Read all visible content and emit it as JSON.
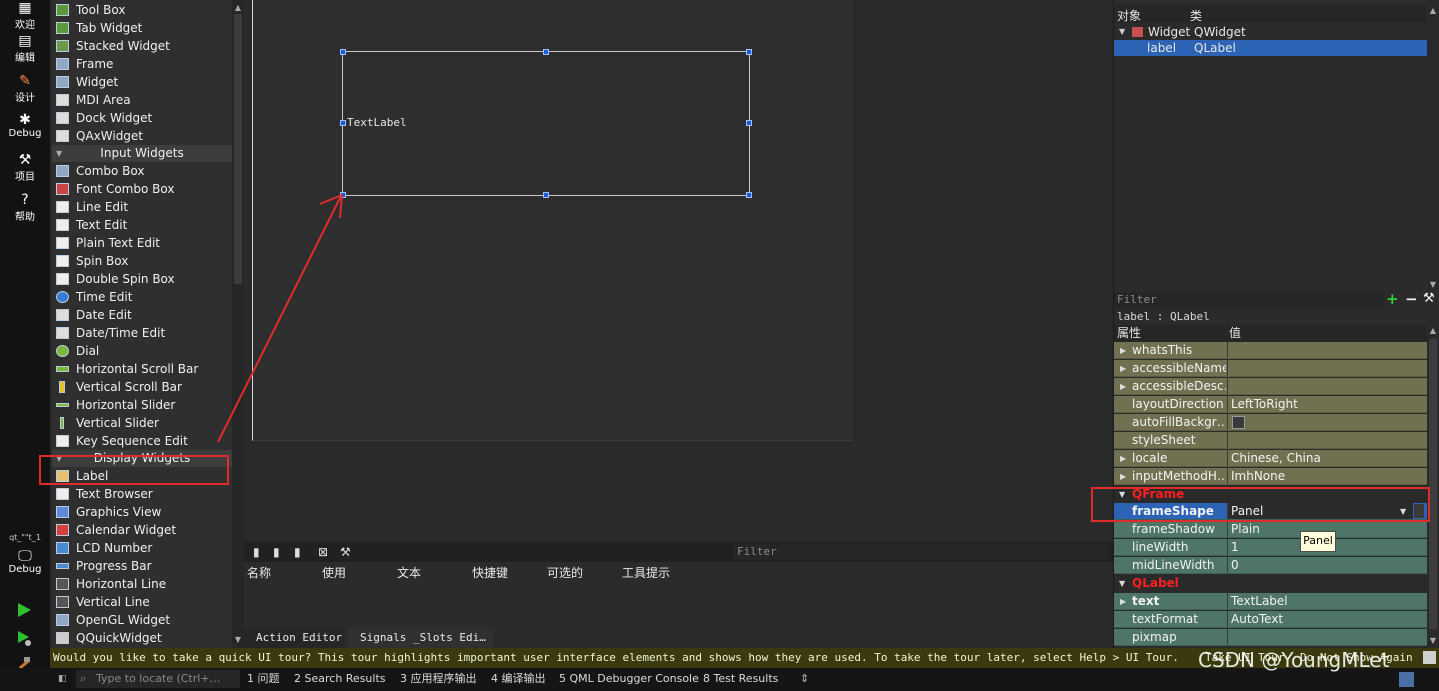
{
  "mode_bar": {
    "items": [
      {
        "label": "欢迎",
        "icon": "grid-icon"
      },
      {
        "label": "编辑",
        "icon": "document-icon"
      },
      {
        "label": "设计",
        "icon": "pencil-icon"
      },
      {
        "label": "Debug",
        "icon": "bug-icon"
      },
      {
        "label": "项目",
        "icon": "wrench-icon"
      },
      {
        "label": "帮助",
        "icon": "help-icon"
      }
    ],
    "project_label": "qt_\"\"t_1",
    "debug_label": "Debug",
    "accent_color": "#2fbf2f"
  },
  "widget_box": {
    "items_top": [
      "Tool Box",
      "Tab Widget",
      "Stacked Widget",
      "Frame",
      "Widget",
      "MDI Area",
      "Dock Widget",
      "QAxWidget"
    ],
    "category_input": "Input Widgets",
    "items_input": [
      "Combo Box",
      "Font Combo Box",
      "Line Edit",
      "Text Edit",
      "Plain Text Edit",
      "Spin Box",
      "Double Spin Box",
      "Time Edit",
      "Date Edit",
      "Date/Time Edit",
      "Dial",
      "Horizontal Scroll Bar",
      "Vertical Scroll Bar",
      "Horizontal Slider",
      "Vertical Slider",
      "Key Sequence Edit"
    ],
    "category_display": "Display Widgets",
    "items_display": [
      "Label",
      "Text Browser",
      "Graphics View",
      "Calendar Widget",
      "LCD Number",
      "Progress Bar",
      "Horizontal Line",
      "Vertical Line",
      "OpenGL Widget",
      "QQuickWidget"
    ]
  },
  "canvas": {
    "label_text": "TextLabel"
  },
  "action_editor": {
    "filter_placeholder": "Filter",
    "columns": [
      "名称",
      "使用",
      "文本",
      "快捷键",
      "可选的",
      "工具提示"
    ],
    "tabs": [
      "Action Editor",
      "Signals _Slots Edi…"
    ]
  },
  "object_inspector": {
    "headers": [
      "对象",
      "类"
    ],
    "rows": [
      {
        "object": "Widget",
        "class": "QWidget"
      },
      {
        "object": "label",
        "class": "QLabel"
      }
    ]
  },
  "property_editor": {
    "filter_placeholder": "Filter",
    "class_line": "label : QLabel",
    "headers": [
      "属性",
      "值"
    ],
    "rows_qobject": [
      {
        "name": "whatsThis",
        "value": ""
      },
      {
        "name": "accessibleName",
        "value": ""
      },
      {
        "name": "accessibleDesc…",
        "value": ""
      },
      {
        "name": "layoutDirection",
        "value": "LeftToRight"
      },
      {
        "name": "autoFillBackgr…",
        "value": ""
      },
      {
        "name": "styleSheet",
        "value": ""
      },
      {
        "name": "locale",
        "value": "Chinese, China"
      },
      {
        "name": "inputMethodH…",
        "value": "ImhNone"
      }
    ],
    "section_qframe": "QFrame",
    "rows_qframe": [
      {
        "name": "frameShape",
        "value": "Panel"
      },
      {
        "name": "frameShadow",
        "value": "Plain"
      },
      {
        "name": "lineWidth",
        "value": "1"
      },
      {
        "name": "midLineWidth",
        "value": "0"
      }
    ],
    "section_qlabel": "QLabel",
    "rows_qlabel": [
      {
        "name": "text",
        "value": "TextLabel"
      },
      {
        "name": "textFormat",
        "value": "AutoText"
      },
      {
        "name": "pixmap",
        "value": ""
      }
    ],
    "tooltip": "Panel"
  },
  "info_bar": {
    "message": "Would you like to take a quick UI tour? This tour highlights important user interface elements and shows how they are used. To take the tour later, select Help > UI Tour.",
    "take_tour": "Take UI Tour",
    "do_not_show": "Do Not Show Again"
  },
  "status_bar": {
    "locate_placeholder": "Type to locate (Ctrl+…",
    "panes": [
      "1 问题",
      "2 Search Results",
      "3 应用程序输出",
      "4 编译输出",
      "5 QML Debugger Console",
      "8 Test Results"
    ]
  },
  "watermark": "CSDN @YoungMLet",
  "colors": {
    "selection_blue": "#2c63b5",
    "qobject_row": "#717152",
    "qlabel_row": "#4e7567",
    "section_red": "#ff1f1f",
    "annotation_red": "#e02b2b"
  }
}
